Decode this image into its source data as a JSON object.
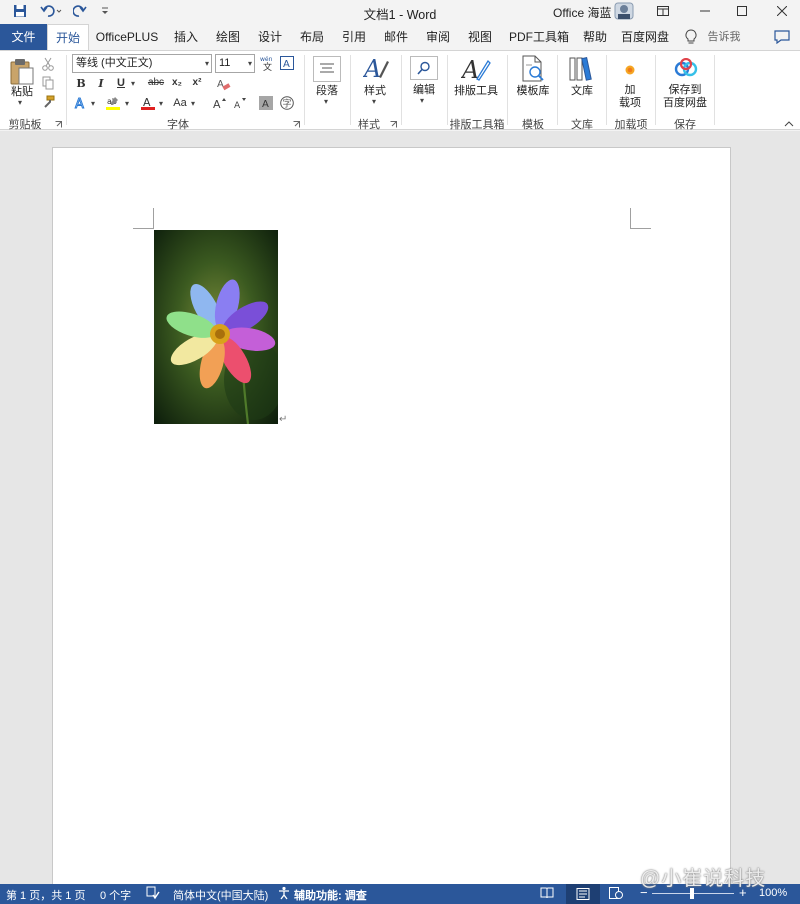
{
  "window": {
    "doc_title": "文档1  -  Word",
    "account_name": "Office 海蓝"
  },
  "tabs": [
    {
      "label": "文件"
    },
    {
      "label": "开始"
    },
    {
      "label": "OfficePLUS"
    },
    {
      "label": "插入"
    },
    {
      "label": "绘图"
    },
    {
      "label": "设计"
    },
    {
      "label": "布局"
    },
    {
      "label": "引用"
    },
    {
      "label": "邮件"
    },
    {
      "label": "审阅"
    },
    {
      "label": "视图"
    },
    {
      "label": "PDF工具箱"
    },
    {
      "label": "帮助"
    },
    {
      "label": "百度网盘"
    }
  ],
  "tell_me": "告诉我",
  "ribbon": {
    "paste_label": "粘贴",
    "clipboard_group": "剪贴板",
    "font_name": "等线 (中文正文)",
    "font_size": "11",
    "font_group": "字体",
    "bold": "B",
    "italic": "I",
    "underline": "U",
    "strike": "abc",
    "subscript": "x₂",
    "superscript": "x²",
    "change_case": "Aa",
    "paragraph_label": "段落",
    "styles_label": "样式",
    "styles_group": "样式",
    "editing_label": "编辑",
    "layout_tool_label": "排版工具",
    "layout_toolbox_group": "排版工具箱",
    "template_label": "模板库",
    "template_group": "模板",
    "library_label": "文库",
    "library_group": "文库",
    "addin_label_1": "加",
    "addin_label_2": "载项",
    "addin_group": "加载项",
    "save_label_1": "保存到",
    "save_label_2": "百度网盘",
    "save_group": "保存"
  },
  "document": {
    "paragraph_mark": "↵"
  },
  "status": {
    "page": "第 1 页，共 1 页",
    "words": "0 个字",
    "language": "简体中文(中国大陆)",
    "accessibility": "辅助功能: 调查",
    "zoom": "100%",
    "zoom_minus": "−",
    "zoom_plus": "+"
  },
  "watermark": "@小崔说科技",
  "colors": {
    "accent": "#2b579a",
    "ribbon_bg": "#ffffff",
    "chrome_bg": "#f3f3f3"
  }
}
